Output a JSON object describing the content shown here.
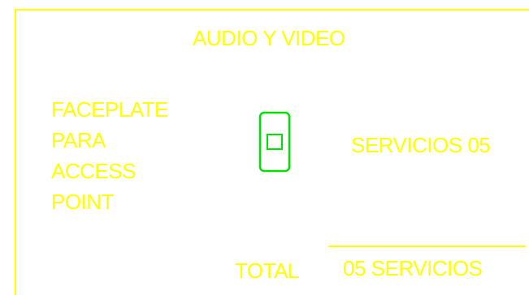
{
  "drawing": {
    "title": "AUDIO Y VIDEO",
    "faceplate_label": [
      "FACEPLATE",
      "PARA",
      "ACCESS",
      "POINT"
    ],
    "services_label": "SERVICIOS 05",
    "total_label": "TOTAL",
    "total_value": "05 SERVICIOS",
    "icon": "faceplate-rj45-outlet-icon"
  },
  "colors": {
    "background": "#ffffff",
    "text": "#ffff00",
    "frame": "#ffff00",
    "symbol": "#00e000"
  }
}
